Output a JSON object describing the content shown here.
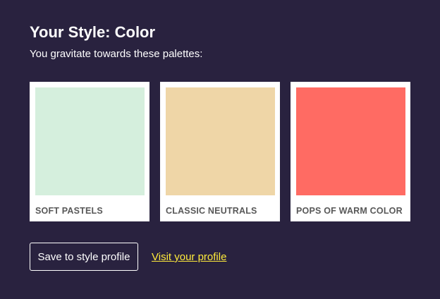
{
  "header": {
    "title": "Your Style: Color",
    "subtitle": "You gravitate towards these palettes:"
  },
  "palettes": [
    {
      "label": "SOFT PASTELS",
      "color": "#d5efdd"
    },
    {
      "label": "CLASSIC NEUTRALS",
      "color": "#efd6a7"
    },
    {
      "label": "POPS OF WARM COLOR",
      "color": "#ff6b63"
    }
  ],
  "actions": {
    "save_label": "Save to style profile",
    "visit_label": "Visit your profile"
  },
  "colors": {
    "background": "#29223f",
    "link": "#ffeb3b"
  }
}
